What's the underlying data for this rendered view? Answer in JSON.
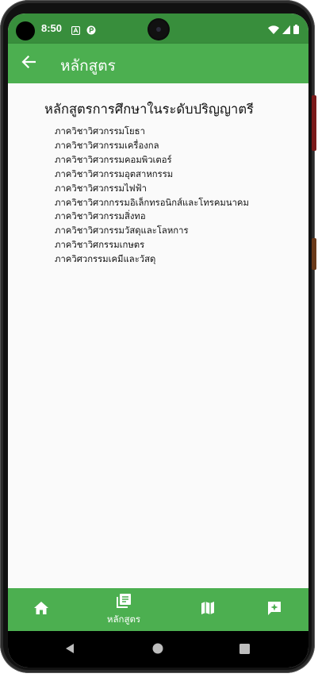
{
  "status_bar": {
    "time": "8:50"
  },
  "app_bar": {
    "title": "หลักสูตร"
  },
  "main": {
    "heading": "หลักสูตรการศึกษาในระดับปริญญาตรี",
    "departments": [
      "ภาควิชาวิศวกรรมโยธา",
      "ภาควิชาวิศวกรรมเครื่องกล",
      "ภาควิชาวิศวกรรมคอมพิวเตอร์",
      "ภาควิชาวิศวกรรมอุตสาหกรรม",
      "ภาควิชาวิศวกรรมไฟฟ้า",
      "ภาควิชาวิศวกกรรมอิเล็กทรอนิกส์และโทรคมนาคม",
      "ภาควิชาวิศวกรรมสิ่งทอ",
      "ภาควิชาวิศวกรรมวัสดุและโลหการ",
      "ภาควิชาวิศกรรมเกษตร",
      "ภาควิศวกรรมเคมีและวัสดุ"
    ]
  },
  "bottom_nav": {
    "items": [
      {
        "icon": "home-icon",
        "label": ""
      },
      {
        "icon": "book-icon",
        "label": "หลักสูตร"
      },
      {
        "icon": "map-icon",
        "label": ""
      },
      {
        "icon": "feedback-icon",
        "label": ""
      }
    ]
  },
  "colors": {
    "status_bar": "#388e3c",
    "primary": "#4caf50",
    "background": "#fafafa"
  }
}
